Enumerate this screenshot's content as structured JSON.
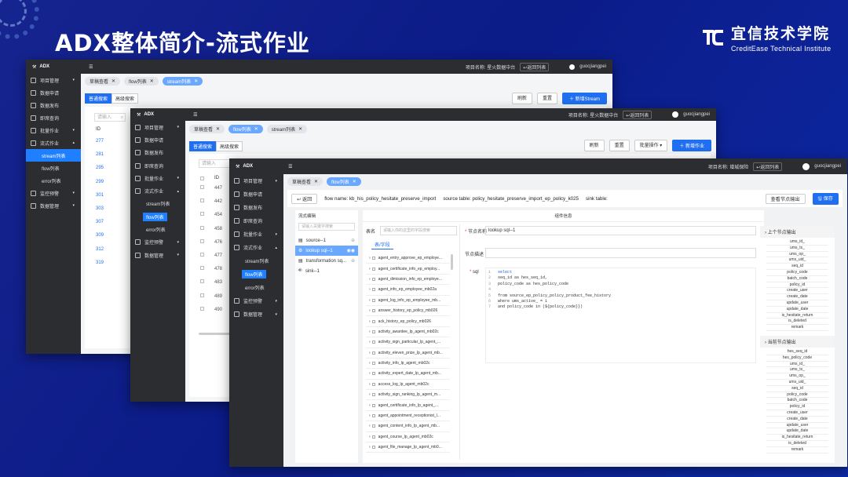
{
  "slide": {
    "title": "ADX整体简介-流式作业",
    "logo_cn": "宜信技术学院",
    "logo_en": "CreditEase Technical Institute"
  },
  "app": {
    "brand": "ADX",
    "user": "guocjiangpei"
  },
  "sidebar": {
    "items": [
      "项目管理",
      "数据申请",
      "数据发布",
      "即席查询",
      "批量作业",
      "流式作业",
      "监控预警",
      "数据管理"
    ],
    "stream_sub": [
      "stream列表",
      "flow列表",
      "error列表"
    ]
  },
  "win1": {
    "project_label": "项目名称: 星火数据中台",
    "return_label": "返回列表",
    "tabs": [
      "草稿查看",
      "flow列表",
      "stream列表"
    ],
    "search_modes": [
      "普通搜索",
      "高级搜索"
    ],
    "search_placeholder": "请输入",
    "refresh": "刷新",
    "reset": "重置",
    "add": "新增Stream",
    "id_header": "ID",
    "ids": [
      "277",
      "281",
      "295",
      "299",
      "301",
      "303",
      "307",
      "309",
      "312",
      "319"
    ]
  },
  "win2": {
    "project_label": "项目名称: 星火数据中台",
    "return_label": "返回列表",
    "tabs": [
      "草稿查看",
      "flow列表",
      "stream列表"
    ],
    "search_modes": [
      "普通搜索",
      "高级搜索"
    ],
    "search_placeholder": "请输入",
    "refresh": "刷新",
    "reset": "重置",
    "batch": "批量操作",
    "add": "新增作业",
    "id_header": "ID",
    "ids": [
      "447",
      "442",
      "454",
      "458",
      "476",
      "477",
      "478",
      "483",
      "489",
      "490"
    ]
  },
  "win3": {
    "project_label": "项目名称: 增城保险",
    "return_label": "返回列表",
    "tabs": [
      "草稿查看",
      "flow列表"
    ],
    "back": "返回",
    "flow_name": "flow name: kb_his_policy_hesitate_preserve_import",
    "source_table": "source table: policy_hesitate_preserve_import_ep_policy_k025",
    "sink_table": "sink table:",
    "view_output": "查看节点输出",
    "save": "保存",
    "flow_edit": "流式编辑",
    "node_search_placeholder": "请输入关键字搜索",
    "nodes": [
      "source--1",
      "lookup sql--1",
      "transformation sq...",
      "sink--1"
    ],
    "component_info": "组件信息",
    "table_name_label": "表名",
    "table_search_placeholder": "请输入你的这里的字段搜索",
    "table_tab": "表/字段",
    "tables": [
      "agent_entry_approve_ep_employe...",
      "agent_certificate_info_ep_employ...",
      "agent_dimission_info_ep_employe...",
      "agent_info_ep_employee_mb02a",
      "agent_log_info_ep_employee_mb...",
      "answer_history_ep_policy_mb026",
      "ack_history_ep_policy_mb026",
      "activity_awardee_lp_agent_mb02c",
      "activity_sign_particular_lp_agent_...",
      "activity_eleven_prize_lp_agent_mb...",
      "activity_info_lp_agent_mb02c",
      "activity_expert_date_lp_agent_mb...",
      "access_log_lp_agent_mb02c",
      "activity_sign_ranking_lp_agent_m...",
      "agent_certificate_info_lp_agent_...",
      "agent_appointment_receptionist_l...",
      "agent_content_info_lp_agent_mb...",
      "agent_course_lp_agent_mb02c",
      "agent_file_manage_lp_agent_mb0..."
    ],
    "node_name_label": "节点名称",
    "node_name_value": "lookup sql--1",
    "node_desc_label": "节点描述",
    "sql_label": "sql",
    "sql_lines": [
      [
        "select"
      ],
      [
        "seq_id as hes_seq_id,"
      ],
      [
        "policy_code as hes_policy_code"
      ],
      [
        ""
      ],
      [
        "from  source_ep_policy_policy_product_fee_history"
      ],
      [
        "where  ums_active_ = 1"
      ],
      [
        "and policy_code in (${policy_code}})"
      ]
    ],
    "upstream_output_title": "上个节点输出",
    "upstream_fields": [
      "ums_id_",
      "ums_ts_",
      "ums_op_",
      "ums_uid_",
      "seq_id",
      "policy_code",
      "batch_code",
      "policy_id",
      "create_user",
      "create_date",
      "update_user",
      "update_date",
      "is_hesitate_return",
      "is_deleted",
      "remark"
    ],
    "current_output_title": "当前节点输出",
    "current_fields": [
      "hes_seq_id",
      "hes_policy_code",
      "ums_id_",
      "ums_ts_",
      "ums_op_",
      "ums_uid_",
      "seq_id",
      "policy_code",
      "batch_code",
      "policy_id",
      "create_user",
      "create_date",
      "update_user",
      "update_date",
      "is_hesitate_return",
      "is_deleted",
      "remark"
    ]
  }
}
